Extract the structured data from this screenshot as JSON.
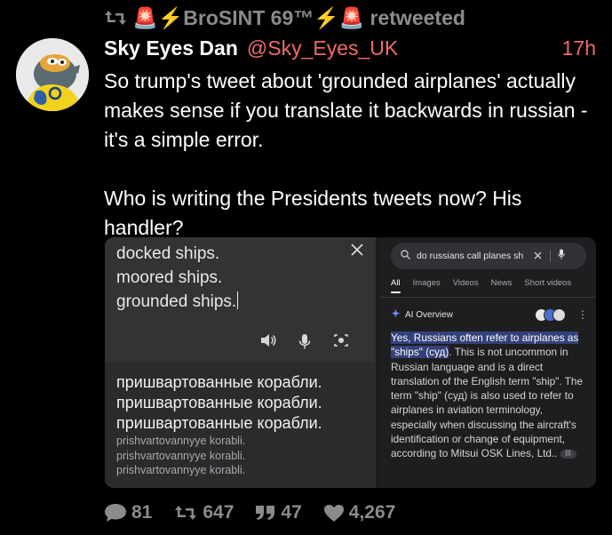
{
  "retweet": {
    "user": "🚨⚡BroSINT 69™⚡🚨",
    "label": "retweeted"
  },
  "tweet": {
    "display_name": "Sky Eyes Dan",
    "handle": "@Sky_Eyes_UK",
    "time": "17h",
    "paragraph1": "So trump's tweet about 'grounded airplanes' actually makes sense if you translate it backwards in russian - it's a simple error.",
    "paragraph2": "Who is writing the Presidents tweets now? His handler?"
  },
  "translate": {
    "source_lines": [
      "docked ships.",
      "moored ships.",
      "grounded ships."
    ],
    "result_lines": [
      "пришвартованные корабли.",
      "пришвартованные корабли.",
      "пришвартованные корабли."
    ],
    "translit_lines": [
      "prishvartovannyye korabli.",
      "prishvartovannyye korabli.",
      "prishvartovannyye korabli."
    ]
  },
  "search": {
    "query": "do russians call planes sh",
    "tabs": [
      "All",
      "Images",
      "Videos",
      "News",
      "Short videos"
    ],
    "ai_label": "AI Overview",
    "highlight": "Yes, Russians often refer to airplanes as \"ships\" (суд)",
    "body": ". This is not uncommon in Russian language and is a direct translation of the English term \"ship\". The term \"ship\" (суд) is also used to refer to airplanes in aviation terminology, especially when discussing the aircraft's identification or change of equipment, according to Mitsui OSK Lines, Ltd.."
  },
  "stats": {
    "replies": "81",
    "retweets": "647",
    "quotes": "47",
    "likes": "4,267"
  },
  "colors": {
    "background": "#000000",
    "handle": "#f06a6a",
    "muted": "#8b8b8b",
    "highlight": "#34417a"
  }
}
